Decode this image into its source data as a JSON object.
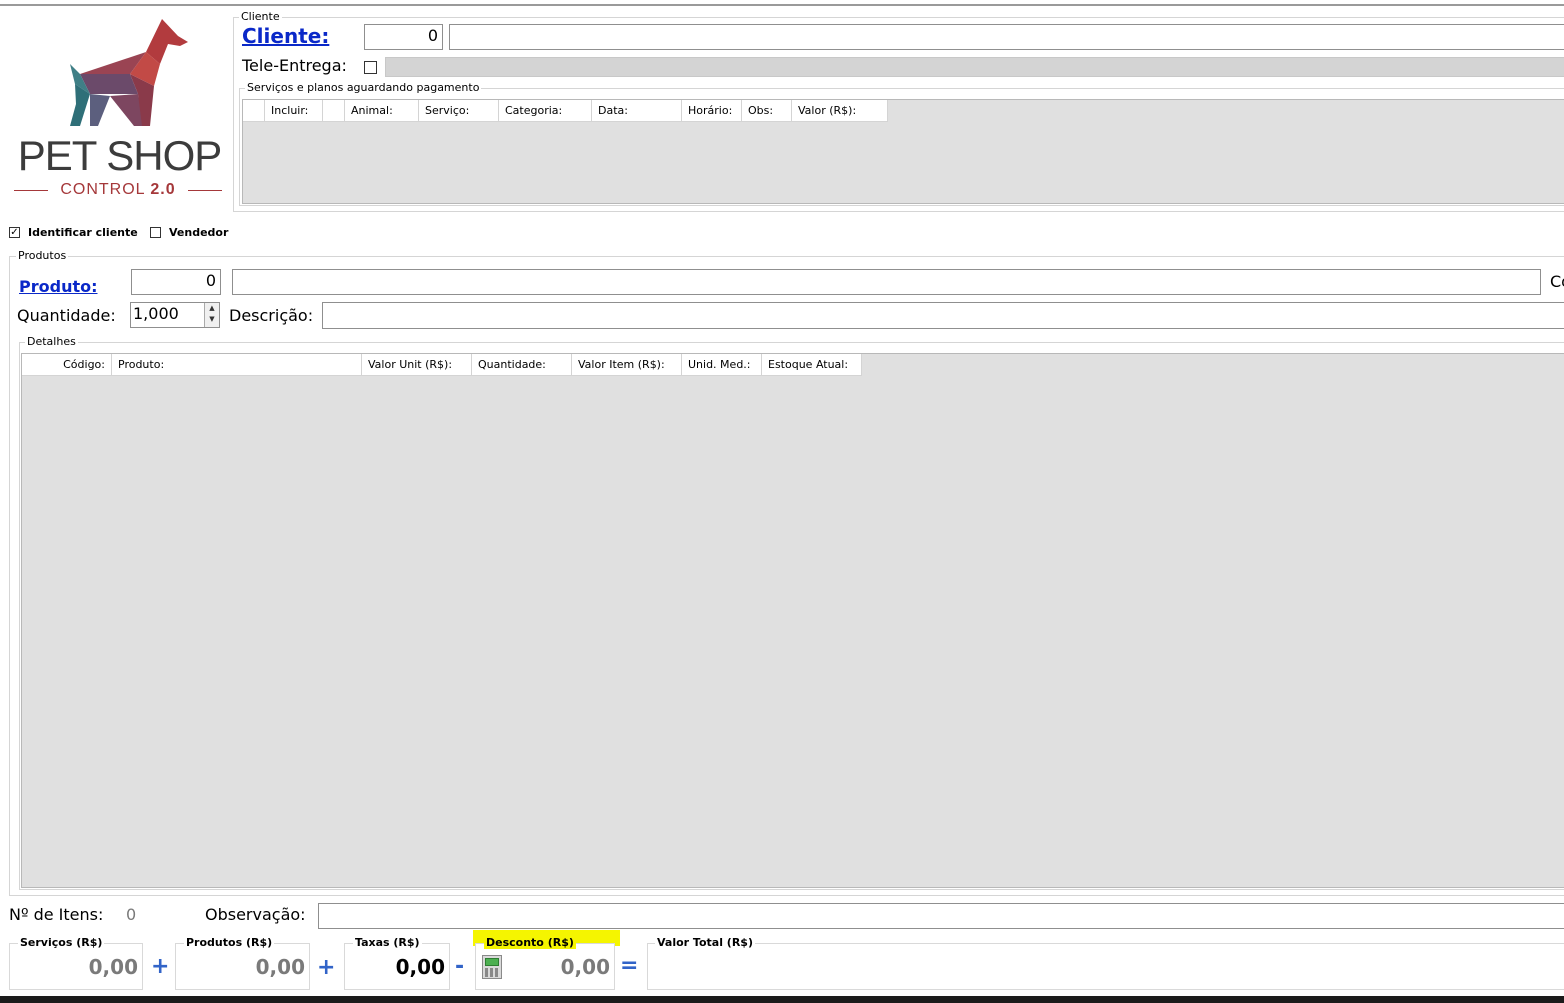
{
  "logo": {
    "title": "PET SHOP",
    "subtitle_prefix": "CONTROL ",
    "subtitle_version": "2.0"
  },
  "cliente_group": {
    "title": "Cliente",
    "link_label": "Cliente:",
    "code_value": "0",
    "name_value": "",
    "tele_label": "Tele-Entrega:",
    "tele_checked": false,
    "services_title": "Serviços e planos aguardando pagamento",
    "services_columns": [
      "Incluir:",
      "",
      "Animal:",
      "Serviço:",
      "Categoria:",
      "Data:",
      "Horário:",
      "Obs:",
      "Valor (R$):"
    ]
  },
  "options": {
    "identificar_label": "Identificar cliente",
    "identificar_checked": true,
    "vendedor_label": "Vendedor",
    "vendedor_checked": false
  },
  "produtos_group": {
    "title": "Produtos",
    "link_label": "Produto:",
    "code_value": "0",
    "name_value": "",
    "right_cut_label": "Co",
    "quantidade_label": "Quantidade:",
    "quantidade_value": "1,000",
    "descricao_label": "Descrição:",
    "descricao_value": "",
    "detalhes_title": "Detalhes",
    "detail_columns": [
      "Código:",
      "Produto:",
      "Valor Unit (R$):",
      "Quantidade:",
      "Valor Item (R$):",
      "Unid. Med.:",
      "Estoque Atual:"
    ]
  },
  "footer": {
    "itens_label": "Nº de Itens:",
    "itens_value": "0",
    "obs_label": "Observação:",
    "obs_value": "",
    "servicos_label": "Serviços (R$)",
    "servicos_value": "0,00",
    "produtos_label": "Produtos (R$)",
    "produtos_value": "0,00",
    "taxas_label": "Taxas (R$)",
    "taxas_value": "0,00",
    "desconto_label": "Desconto (R$)",
    "desconto_value": "0,00",
    "valor_total_label": "Valor Total (R$)",
    "op_plus": "+",
    "op_minus": "-",
    "op_equals": "=",
    "highlight_color": "#f5f500"
  },
  "colors": {
    "link": "#0a28c8",
    "grid_bg": "#e0e0e0",
    "operator": "#3264c8",
    "logo_text": "#3c3c3c",
    "logo_accent": "#a5383a"
  },
  "icons": {
    "logo": "dog-icon",
    "calculator": "calculator-icon"
  }
}
